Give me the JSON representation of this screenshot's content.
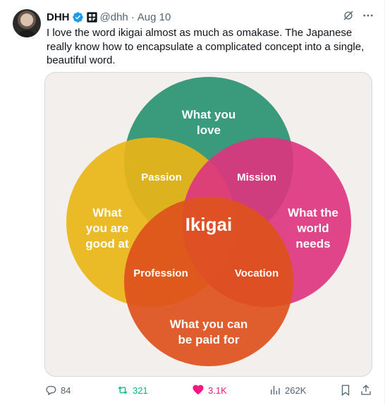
{
  "post": {
    "author_name": "DHH",
    "handle": "@dhh",
    "separator": "·",
    "date": "Aug 10",
    "text": "I love the word ikigai almost as much as omakase. The Japanese really know how to encapsulate a complicated concept into a single, beautiful word."
  },
  "image": {
    "circles": {
      "love": [
        "What you",
        "love"
      ],
      "good_at": [
        "What",
        "you are",
        "good at"
      ],
      "world_needs": [
        "What the",
        "world",
        "needs"
      ],
      "paid_for": [
        "What you can",
        "be paid for"
      ]
    },
    "overlaps": {
      "passion": "Passion",
      "mission": "Mission",
      "profession": "Profession",
      "vocation": "Vocation"
    },
    "center": "Ikigai",
    "colors": {
      "love": "#2a9d7c",
      "good_at": "#f6c218",
      "world_needs": "#e8398a",
      "paid_for": "#e9571e",
      "background": "#f3efec"
    }
  },
  "actions": {
    "replies": "84",
    "reposts": "321",
    "likes": "3.1K",
    "views": "262K"
  },
  "icons": {
    "verified": "verified-badge-icon",
    "affiliate": "affiliate-badge-icon",
    "grok": "grok-icon",
    "more": "more-icon",
    "reply": "reply-icon",
    "repost": "repost-icon",
    "like": "heart-icon",
    "views": "views-icon",
    "bookmark": "bookmark-icon",
    "share": "share-icon"
  }
}
